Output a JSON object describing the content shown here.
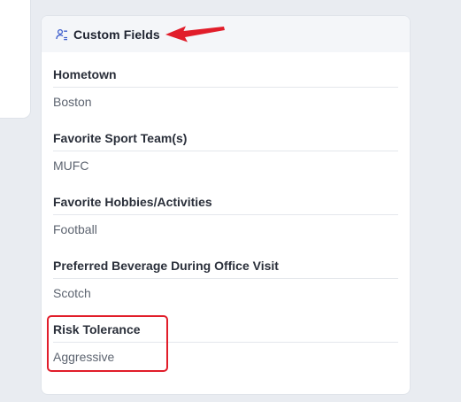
{
  "card": {
    "title": "Custom Fields",
    "icon": "users-settings-icon"
  },
  "fields": [
    {
      "label": "Hometown",
      "value": "Boston"
    },
    {
      "label": "Favorite Sport Team(s)",
      "value": "MUFC"
    },
    {
      "label": "Favorite Hobbies/Activities",
      "value": "Football"
    },
    {
      "label": "Preferred Beverage During Office Visit",
      "value": "Scotch"
    },
    {
      "label": "Risk Tolerance",
      "value": "Aggressive"
    }
  ],
  "annotations": {
    "arrow_color": "#e11d2a",
    "highlight_color": "#e11d2a"
  }
}
